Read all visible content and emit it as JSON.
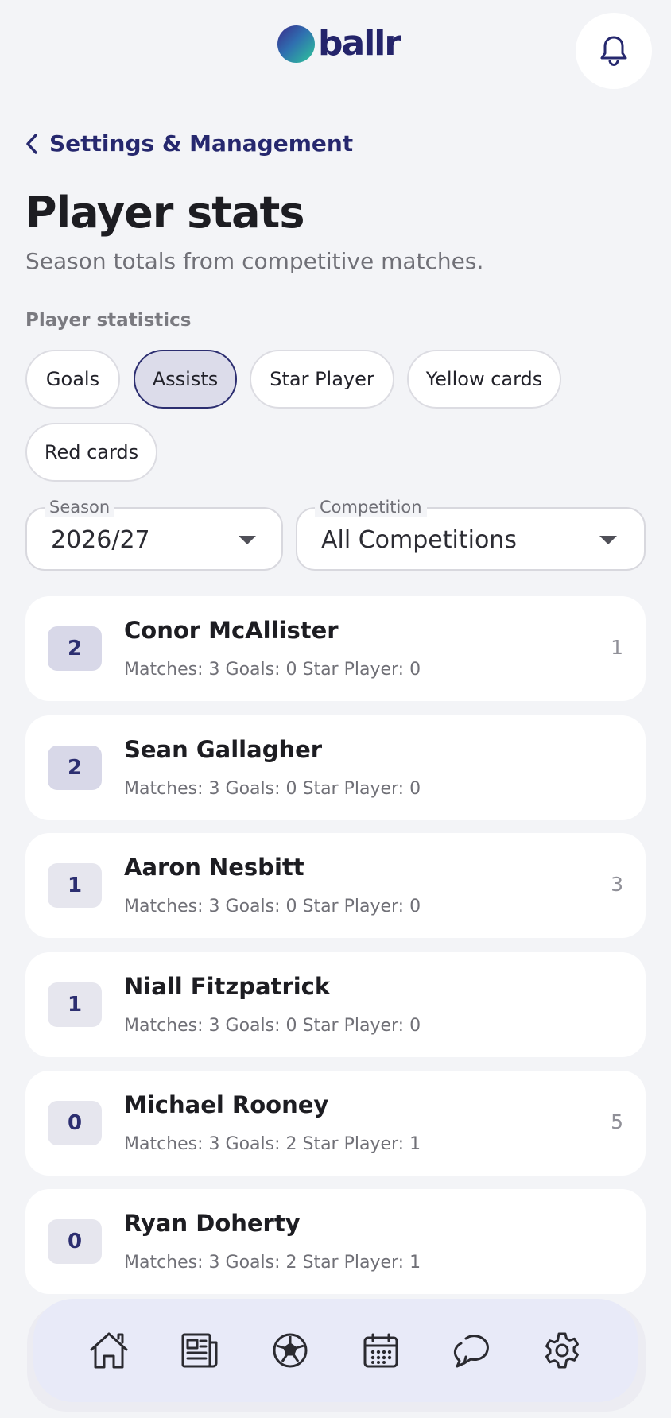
{
  "header": {
    "logo_text": "ballr",
    "bell_icon": "bell-icon"
  },
  "back_link": {
    "label": "Settings & Management",
    "icon": "chevron-left-icon"
  },
  "page": {
    "title": "Player stats",
    "subtitle": "Season totals from competitive matches.",
    "section_label": "Player statistics"
  },
  "filters": {
    "chips": [
      {
        "label": "Goals",
        "active": false
      },
      {
        "label": "Assists",
        "active": true
      },
      {
        "label": "Star Player",
        "active": false
      },
      {
        "label": "Yellow cards",
        "active": false
      },
      {
        "label": "Red cards",
        "active": false
      }
    ],
    "season": {
      "label": "Season",
      "value": "2026/27"
    },
    "competition": {
      "label": "Competition",
      "value": "All Competitions"
    }
  },
  "players": [
    {
      "rank": "2",
      "name": "Conor McAllister",
      "meta": "Matches: 3 Goals: 0 Star Player: 0",
      "value": "1"
    },
    {
      "rank": "2",
      "name": "Sean Gallagher",
      "meta": "Matches: 3 Goals: 0 Star Player: 0",
      "value": ""
    },
    {
      "rank": "1",
      "name": "Aaron Nesbitt",
      "meta": "Matches: 3 Goals: 0 Star Player: 0",
      "value": "3"
    },
    {
      "rank": "1",
      "name": "Niall Fitzpatrick",
      "meta": "Matches: 3 Goals: 0 Star Player: 0",
      "value": ""
    },
    {
      "rank": "0",
      "name": "Michael Rooney",
      "meta": "Matches: 3 Goals: 2 Star Player: 1",
      "value": "5"
    },
    {
      "rank": "0",
      "name": "Ryan Doherty",
      "meta": "Matches: 3 Goals: 2 Star Player: 1",
      "value": ""
    }
  ],
  "bottom_nav": {
    "items": [
      "home-icon",
      "news-icon",
      "football-icon",
      "calendar-icon",
      "chat-icon",
      "settings-icon"
    ]
  },
  "colors": {
    "accent": "#26286e",
    "background": "#f3f4f7",
    "chip_active_bg": "#dcdcea",
    "nav_bg": "#e8eaf8"
  }
}
